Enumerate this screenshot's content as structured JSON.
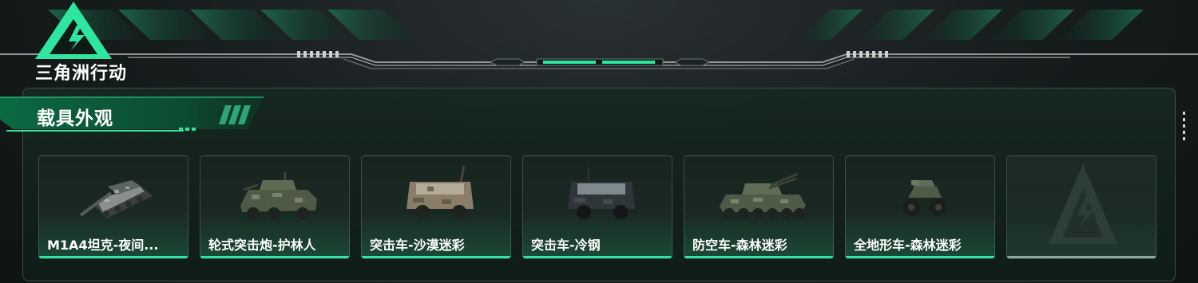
{
  "brand": {
    "name": "三角洲行动"
  },
  "panel": {
    "title": "载具外观"
  },
  "vehicles": [
    {
      "label": "M1A4坦克-夜间...",
      "icon": "tank-icon"
    },
    {
      "label": "轮式突击炮-护林人",
      "icon": "wheeled-assault-gun-icon"
    },
    {
      "label": "突击车-沙漠迷彩",
      "icon": "assault-vehicle-icon"
    },
    {
      "label": "突击车-冷钢",
      "icon": "assault-vehicle-icon"
    },
    {
      "label": "防空车-森林迷彩",
      "icon": "anti-air-vehicle-icon"
    },
    {
      "label": "全地形车-森林迷彩",
      "icon": "atv-icon"
    }
  ],
  "colors": {
    "accent": "#2ee6a0",
    "panel_bg": "#14241e",
    "header_green": "#0e5a3a"
  }
}
